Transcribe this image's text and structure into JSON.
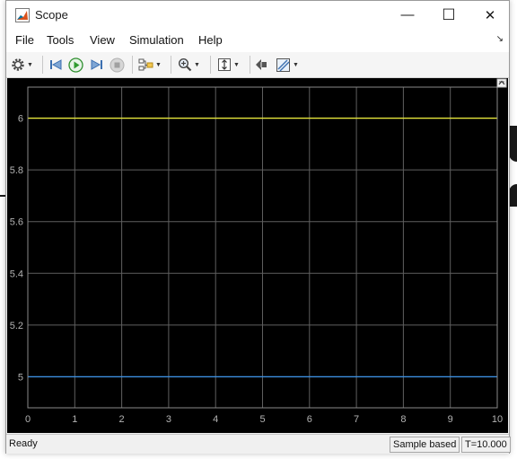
{
  "window": {
    "title": "Scope",
    "minimize_glyph": "—",
    "maximize_glyph": "☐",
    "close_glyph": "✕"
  },
  "menu": {
    "items": [
      {
        "label": "File"
      },
      {
        "label": "Tools"
      },
      {
        "label": "View"
      },
      {
        "label": "Simulation"
      },
      {
        "label": "Help"
      }
    ]
  },
  "toolbar": {
    "icons": [
      "settings-icon",
      "step-back-icon",
      "run-icon",
      "step-forward-icon",
      "stop-icon",
      "highlight-block-icon",
      "zoom-icon",
      "scale-axes-icon",
      "restore-view-icon",
      "cursor-measure-icon"
    ]
  },
  "status": {
    "state": "Ready",
    "mode": "Sample based",
    "time": "T=10.000"
  },
  "colors": {
    "plot_background": "#000000",
    "grid": "#5f5f5f",
    "axis_text": "#b3b3b3",
    "series_yellow": "#e6e63c",
    "series_blue": "#3d8fe0"
  },
  "chart_data": {
    "type": "line",
    "title": "",
    "xlabel": "",
    "ylabel": "",
    "xlim": [
      0,
      10
    ],
    "ylim": [
      4.88,
      6.12
    ],
    "xticks": [
      "0",
      "1",
      "2",
      "3",
      "4",
      "5",
      "6",
      "7",
      "8",
      "9",
      "10"
    ],
    "yticks": [
      "5",
      "5.2",
      "5.4",
      "5.6",
      "5.8",
      "6"
    ],
    "grid": true,
    "series": [
      {
        "color": "#e6e63c",
        "x": [
          0,
          10
        ],
        "y": [
          6,
          6
        ]
      },
      {
        "color": "#3d8fe0",
        "x": [
          0,
          10
        ],
        "y": [
          5,
          5
        ]
      }
    ]
  }
}
